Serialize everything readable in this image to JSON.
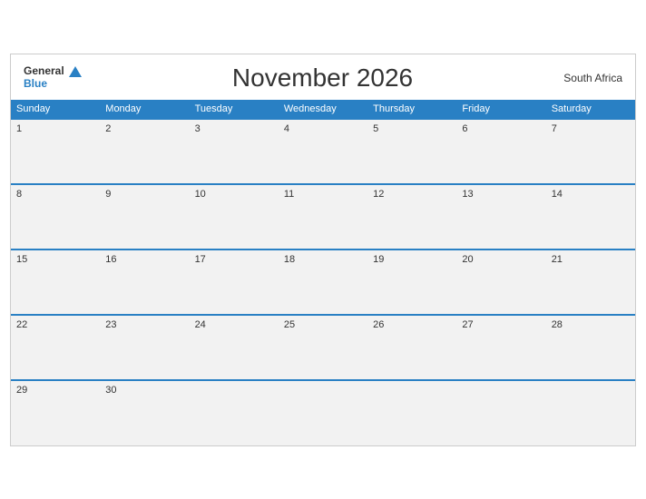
{
  "header": {
    "logo_general": "General",
    "logo_blue": "Blue",
    "title": "November 2026",
    "country": "South Africa"
  },
  "weekdays": [
    "Sunday",
    "Monday",
    "Tuesday",
    "Wednesday",
    "Thursday",
    "Friday",
    "Saturday"
  ],
  "weeks": [
    [
      "1",
      "2",
      "3",
      "4",
      "5",
      "6",
      "7"
    ],
    [
      "8",
      "9",
      "10",
      "11",
      "12",
      "13",
      "14"
    ],
    [
      "15",
      "16",
      "17",
      "18",
      "19",
      "20",
      "21"
    ],
    [
      "22",
      "23",
      "24",
      "25",
      "26",
      "27",
      "28"
    ],
    [
      "29",
      "30",
      "",
      "",
      "",
      "",
      ""
    ]
  ]
}
